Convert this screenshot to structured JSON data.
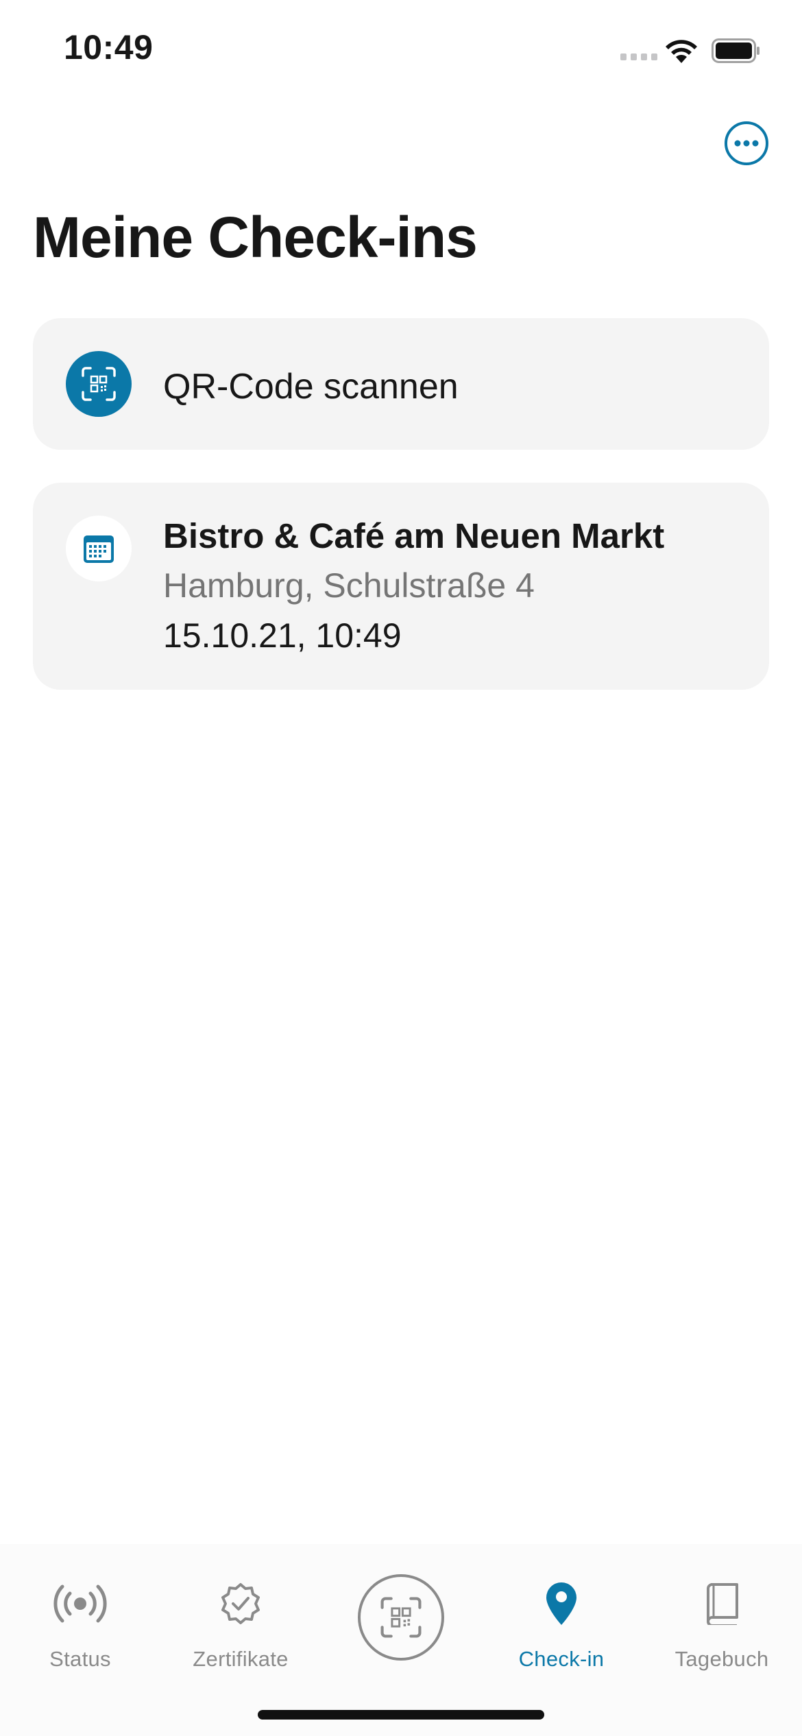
{
  "status_bar": {
    "time": "10:49"
  },
  "header": {
    "title": "Meine Check-ins",
    "more_icon": "ellipsis-circle-icon"
  },
  "scan_card": {
    "label": "QR-Code scannen",
    "icon": "qr-code-scan-icon",
    "accent": "#0b78a8"
  },
  "checkins": [
    {
      "venue": "Bistro & Café am Neuen Markt",
      "address": "Hamburg, Schulstraße 4",
      "datetime": "15.10.21, 10:49",
      "icon": "calendar-icon"
    }
  ],
  "tab_bar": {
    "items": [
      {
        "label": "Status",
        "icon": "broadcast-icon",
        "active": false
      },
      {
        "label": "Zertifikate",
        "icon": "verified-badge-icon",
        "active": false
      },
      {
        "label": "",
        "icon": "qr-code-scan-icon",
        "active": false
      },
      {
        "label": "Check-in",
        "icon": "location-pin-icon",
        "active": true
      },
      {
        "label": "Tagebuch",
        "icon": "book-icon",
        "active": false
      }
    ],
    "active_color": "#0b78a8",
    "inactive_color": "#8a8a8a"
  }
}
